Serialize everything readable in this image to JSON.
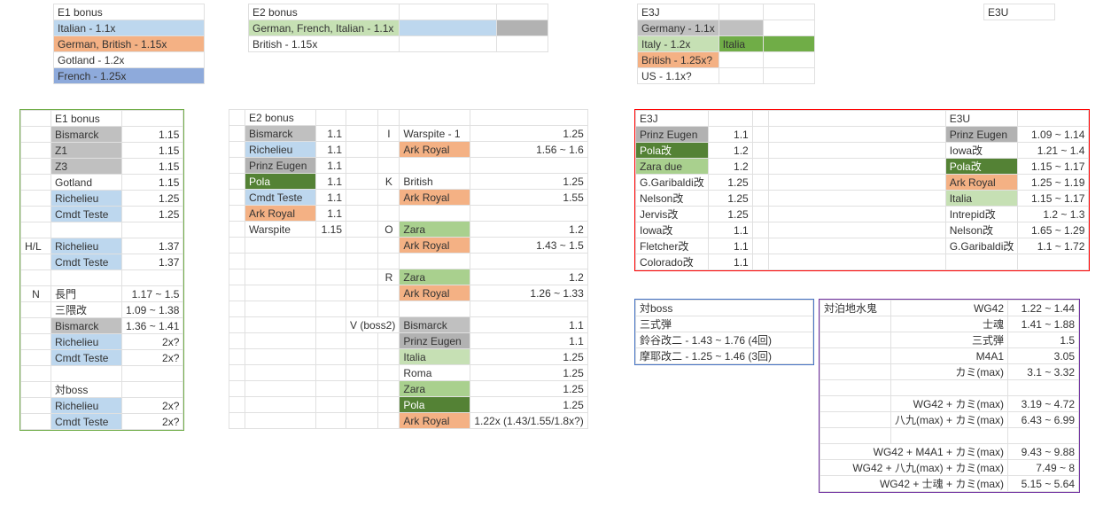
{
  "a": {
    "0": "E1 bonus",
    "1": "Italian - 1.1x",
    "2": "German, British - 1.15x",
    "3": "Gotland - 1.2x",
    "4": "French - 1.25x"
  },
  "b": {
    "0": "E2 bonus",
    "1": "German, French, Italian - 1.1x",
    "2": "British - 1.15x"
  },
  "c": {
    "0": "E3J",
    "1": "Germany - 1.1x",
    "2": "Italy - 1.2x",
    "2b": "Italia",
    "3": "British - 1.25x?",
    "4": "US - 1.1x?"
  },
  "d": {
    "0": "E3U"
  },
  "e1": {
    "title": "E1 bonus",
    "r": [
      [
        "Bismarck",
        "1.15",
        "grey"
      ],
      [
        "Z1",
        "1.15",
        "grey"
      ],
      [
        "Z3",
        "1.15",
        "grey"
      ],
      [
        "Gotland",
        "1.15",
        ""
      ],
      [
        "Richelieu",
        "1.25",
        "bluel"
      ],
      [
        "Cmdt Teste",
        "1.25",
        "bluel"
      ]
    ],
    "hl": "H/L",
    "hlr": [
      [
        "Richelieu",
        "1.37",
        "bluel"
      ],
      [
        "Cmdt Teste",
        "1.37",
        "bluel"
      ]
    ],
    "n": "N",
    "nr": [
      [
        "長門",
        "1.17 ~ 1.5",
        ""
      ],
      [
        "三隈改",
        "1.09 ~ 1.38",
        ""
      ],
      [
        "Bismarck",
        "1.36 ~ 1.41",
        "grey"
      ],
      [
        "Richelieu",
        "2x?",
        "bluel"
      ],
      [
        "Cmdt Teste",
        "2x?",
        "bluel"
      ]
    ],
    "vb": "対boss",
    "vbr": [
      [
        "Richelieu",
        "2x?",
        "bluel"
      ],
      [
        "Cmdt Teste",
        "2x?",
        "bluel"
      ]
    ]
  },
  "e2": {
    "title": "E2 bonus",
    "r": [
      [
        "Bismarck",
        "1.1",
        "grey"
      ],
      [
        "Richelieu",
        "1.1",
        "bluel"
      ],
      [
        "Prinz Eugen",
        "1.1",
        "grey2"
      ],
      [
        "Pola",
        "1.1",
        "green3"
      ],
      [
        "Cmdt Teste",
        "1.1",
        "bluel"
      ],
      [
        "Ark Royal",
        "1.1",
        "orange"
      ],
      [
        "Warspite",
        "1.15",
        ""
      ]
    ],
    "I": "I",
    "Ir": [
      [
        "Warspite - 1",
        "1.25",
        ""
      ],
      [
        "Ark Royal",
        "1.56 ~ 1.6",
        "orange"
      ]
    ],
    "K": "K",
    "Kr": [
      [
        "British",
        "1.25",
        ""
      ],
      [
        "Ark Royal",
        "1.55",
        "orange"
      ]
    ],
    "O": "O",
    "Or": [
      [
        "Zara",
        "1.2",
        "green2"
      ],
      [
        "Ark Royal",
        "1.43 ~ 1.5",
        "orange"
      ]
    ],
    "R": "R",
    "Rr": [
      [
        "Zara",
        "1.2",
        "green2"
      ],
      [
        "Ark Royal",
        "1.26 ~ 1.33",
        "orange"
      ]
    ],
    "V": "V (boss2)",
    "Vr": [
      [
        "Bismarck",
        "1.1",
        "grey"
      ],
      [
        "Prinz Eugen",
        "1.1",
        "grey2"
      ],
      [
        "Italia",
        "1.25",
        "green1"
      ],
      [
        "Roma",
        "1.25",
        ""
      ],
      [
        "Zara",
        "1.25",
        "green2"
      ],
      [
        "Pola",
        "1.25",
        "green3"
      ]
    ],
    "Vlast": [
      "Ark Royal",
      "1.22x (1.43/1.55/1.8x?)",
      "orange"
    ]
  },
  "e3j": {
    "title": "E3J",
    "r": [
      [
        "Prinz Eugen",
        "1.1",
        "grey2"
      ],
      [
        "Pola改",
        "1.2",
        "green3"
      ],
      [
        "Zara due",
        "1.2",
        "green2"
      ],
      [
        "G.Garibaldi改",
        "1.25",
        ""
      ],
      [
        "Nelson改",
        "1.25",
        ""
      ],
      [
        "Jervis改",
        "1.25",
        ""
      ],
      [
        "Iowa改",
        "1.1",
        ""
      ],
      [
        "Fletcher改",
        "1.1",
        ""
      ],
      [
        "Colorado改",
        "1.1",
        ""
      ]
    ]
  },
  "e3u": {
    "title": "E3U",
    "r": [
      [
        "Prinz Eugen",
        "1.09 ~ 1.14",
        "grey2"
      ],
      [
        "Iowa改",
        "1.21 ~ 1.4",
        ""
      ],
      [
        "Pola改",
        "1.15 ~ 1.17",
        "green3"
      ],
      [
        "Ark Royal",
        "1.25 ~ 1.19",
        "orange"
      ],
      [
        "Italia",
        "1.15 ~ 1.17",
        "green1"
      ],
      [
        "Intrepid改",
        "1.2 ~ 1.3",
        ""
      ],
      [
        "Nelson改",
        "1.65 ~ 1.29",
        ""
      ],
      [
        "G.Garibaldi改",
        "1.1 ~ 1.72",
        ""
      ]
    ]
  },
  "vb2": {
    "t": "対boss",
    "a": "三式弾",
    "b": "鈴谷改二 - 1.43 ~ 1.76 (4回)",
    "c": "摩耶改二 - 1.25 ~ 1.46 (3回)"
  },
  "anch": {
    "t": "対泊地水鬼",
    "r": [
      [
        "WG42",
        "1.22 ~ 1.44"
      ],
      [
        "士魂",
        "1.41 ~ 1.88"
      ],
      [
        "三式弾",
        "1.5"
      ],
      [
        "M4A1",
        "3.05"
      ],
      [
        "カミ(max)",
        "3.1 ~ 3.32"
      ]
    ],
    "r2": [
      [
        "WG42 + カミ(max)",
        "3.19 ~ 4.72"
      ],
      [
        "八九(max) + カミ(max)",
        "6.43 ~ 6.99"
      ]
    ],
    "r3": [
      [
        "WG42 + M4A1 + カミ(max)",
        "9.43 ~ 9.88"
      ],
      [
        "WG42 + 八九(max) + カミ(max)",
        "7.49 ~ 8"
      ],
      [
        "WG42 + 士魂 + カミ(max)",
        "5.15 ~ 5.64"
      ]
    ]
  }
}
